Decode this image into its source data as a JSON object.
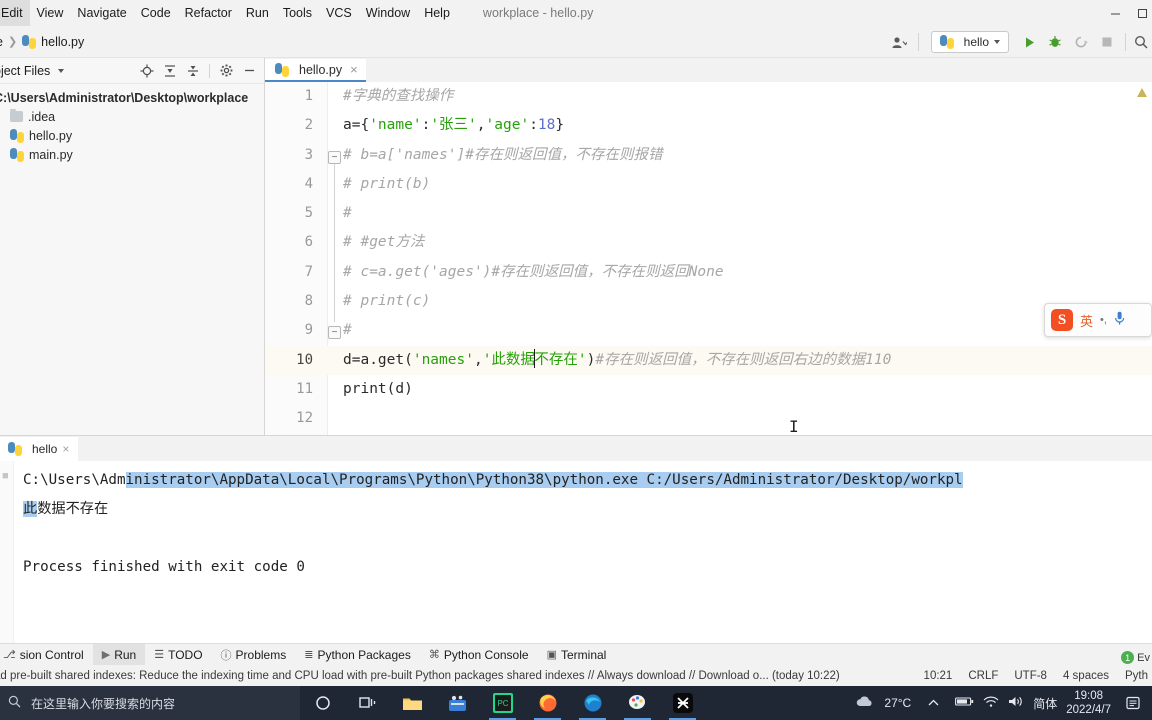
{
  "window": {
    "title": "workplace - hello.py",
    "menus": [
      "Edit",
      "View",
      "Navigate",
      "Code",
      "Refactor",
      "Run",
      "Tools",
      "VCS",
      "Window",
      "Help"
    ],
    "controls": {
      "minimize": "minimize-icon",
      "maximize": "maximize-icon"
    }
  },
  "navbar": {
    "breadcrumb_tail": "e",
    "breadcrumb_file": "hello.py",
    "account_icon": "account-icon",
    "run_config": "hello",
    "run_icon": "run-icon",
    "debug_icon": "debug-icon",
    "coverage_icon": "run-coverage-icon",
    "stop_icon": "stop-icon",
    "search_icon": "search-icon"
  },
  "sidebar": {
    "title": "oject Files",
    "tools": [
      "locate-icon",
      "expand-all-icon",
      "collapse-all-icon",
      "settings-icon",
      "hide-icon"
    ],
    "root": "C:\\Users\\Administrator\\Desktop\\workplace",
    "items": [
      {
        "label": ".idea",
        "icon": "folder-icon"
      },
      {
        "label": "hello.py",
        "icon": "python-file-icon"
      },
      {
        "label": "main.py",
        "icon": "python-file-icon"
      }
    ]
  },
  "editor": {
    "tab": {
      "label": "hello.py",
      "close": "×",
      "icon": "python-file-icon"
    },
    "lines": [
      {
        "n": "1",
        "segments": [
          {
            "t": "#字典的查找操作",
            "c": "cmt"
          }
        ]
      },
      {
        "n": "2",
        "segments": [
          {
            "t": "a={",
            "c": "kw"
          },
          {
            "t": "'name'",
            "c": "str"
          },
          {
            "t": ":",
            "c": "kw"
          },
          {
            "t": "'张三'",
            "c": "str"
          },
          {
            "t": ",",
            "c": "kw"
          },
          {
            "t": "'age'",
            "c": "str"
          },
          {
            "t": ":",
            "c": "kw"
          },
          {
            "t": "18",
            "c": "num-lit"
          },
          {
            "t": "}",
            "c": "kw"
          }
        ]
      },
      {
        "n": "3",
        "segments": [
          {
            "t": "# b=a['names']#存在则返回值，不存在则报错",
            "c": "cmt"
          }
        ]
      },
      {
        "n": "4",
        "segments": [
          {
            "t": "# print(b)",
            "c": "cmt"
          }
        ]
      },
      {
        "n": "5",
        "segments": [
          {
            "t": "#",
            "c": "cmt"
          }
        ]
      },
      {
        "n": "6",
        "segments": [
          {
            "t": "# #get方法",
            "c": "cmt"
          }
        ]
      },
      {
        "n": "7",
        "segments": [
          {
            "t": "# c=a.get('ages')#存在则返回值，不存在则返回None",
            "c": "cmt"
          }
        ]
      },
      {
        "n": "8",
        "segments": [
          {
            "t": "# print(c)",
            "c": "cmt"
          }
        ]
      },
      {
        "n": "9",
        "segments": [
          {
            "t": "#",
            "c": "cmt"
          }
        ]
      },
      {
        "n": "10",
        "current": true,
        "segments": [
          {
            "t": "d=a.get(",
            "c": "kw"
          },
          {
            "t": "'names'",
            "c": "str"
          },
          {
            "t": ",",
            "c": "kw"
          },
          {
            "t": "'此数据",
            "c": "str"
          },
          {
            "t": "CARET",
            "c": "caret"
          },
          {
            "t": "不存在'",
            "c": "str"
          },
          {
            "t": ")",
            "c": "kw"
          },
          {
            "t": "#存在则返回值，不存在则返回右边的数据110",
            "c": "cmt"
          }
        ]
      },
      {
        "n": "11",
        "segments": [
          {
            "t": "print(d)",
            "c": "kw"
          }
        ]
      },
      {
        "n": "12",
        "segments": []
      }
    ],
    "fold_rows": [
      "3",
      "9"
    ],
    "inspection_icon": "warning-triangle-icon"
  },
  "ime": {
    "logo": "S",
    "mode": "英",
    "punct": "•,",
    "mic_icon": "microphone-icon"
  },
  "console": {
    "tab": {
      "label": "hello",
      "close": "×",
      "icon": "python-file-icon"
    },
    "command_prefix": "C:\\Users\\Adm",
    "command_selected": "inistrator\\AppData\\Local\\Programs\\Python\\Python38\\python.exe C:/Users/Administrator/Desktop/workpl",
    "output_selected": "此",
    "output_rest": "数据不存在",
    "exit_line": "Process finished with exit code 0"
  },
  "tool_windows": [
    {
      "label": "sion Control",
      "icon": "version-control-icon",
      "active": false
    },
    {
      "label": "Run",
      "icon": "run-icon",
      "active": true
    },
    {
      "label": "TODO",
      "icon": "todo-icon",
      "active": false
    },
    {
      "label": "Problems",
      "icon": "problems-icon",
      "active": false
    },
    {
      "label": "Python Packages",
      "icon": "packages-icon",
      "active": false
    },
    {
      "label": "Python Console",
      "icon": "python-console-icon",
      "active": false
    },
    {
      "label": "Terminal",
      "icon": "terminal-icon",
      "active": false
    }
  ],
  "status": {
    "message": "ad pre-built shared indexes: Reduce the indexing time and CPU load with pre-built Python packages shared indexes // Always download // Download o... (today 10:22)",
    "caret_pos": "10:21",
    "line_sep": "CRLF",
    "encoding": "UTF-8",
    "indent": "4 spaces",
    "interpreter": "Pyth",
    "event_log": "Ev",
    "event_count": "1"
  },
  "taskbar": {
    "search_placeholder": "在这里输入你要搜索的内容",
    "search_icon": "search-icon",
    "buttons": [
      {
        "name": "cortana-icon"
      },
      {
        "name": "task-view-icon"
      },
      {
        "name": "file-explorer-icon"
      },
      {
        "name": "meeting-app-icon"
      },
      {
        "name": "pycharm-icon",
        "open": true
      },
      {
        "name": "firefox-icon",
        "open": true
      },
      {
        "name": "edge-icon",
        "open": true
      },
      {
        "name": "paint-icon",
        "open": true
      },
      {
        "name": "capcut-icon",
        "open": true
      }
    ],
    "weather": "27°C",
    "weather_icon": "cloud-icon",
    "tray": [
      "chevron-up-icon",
      "battery-icon",
      "wifi-icon",
      "volume-icon"
    ],
    "ime_lang": "简体",
    "time": "19:08",
    "date": "2022/4/7",
    "notifications_icon": "notification-icon"
  }
}
